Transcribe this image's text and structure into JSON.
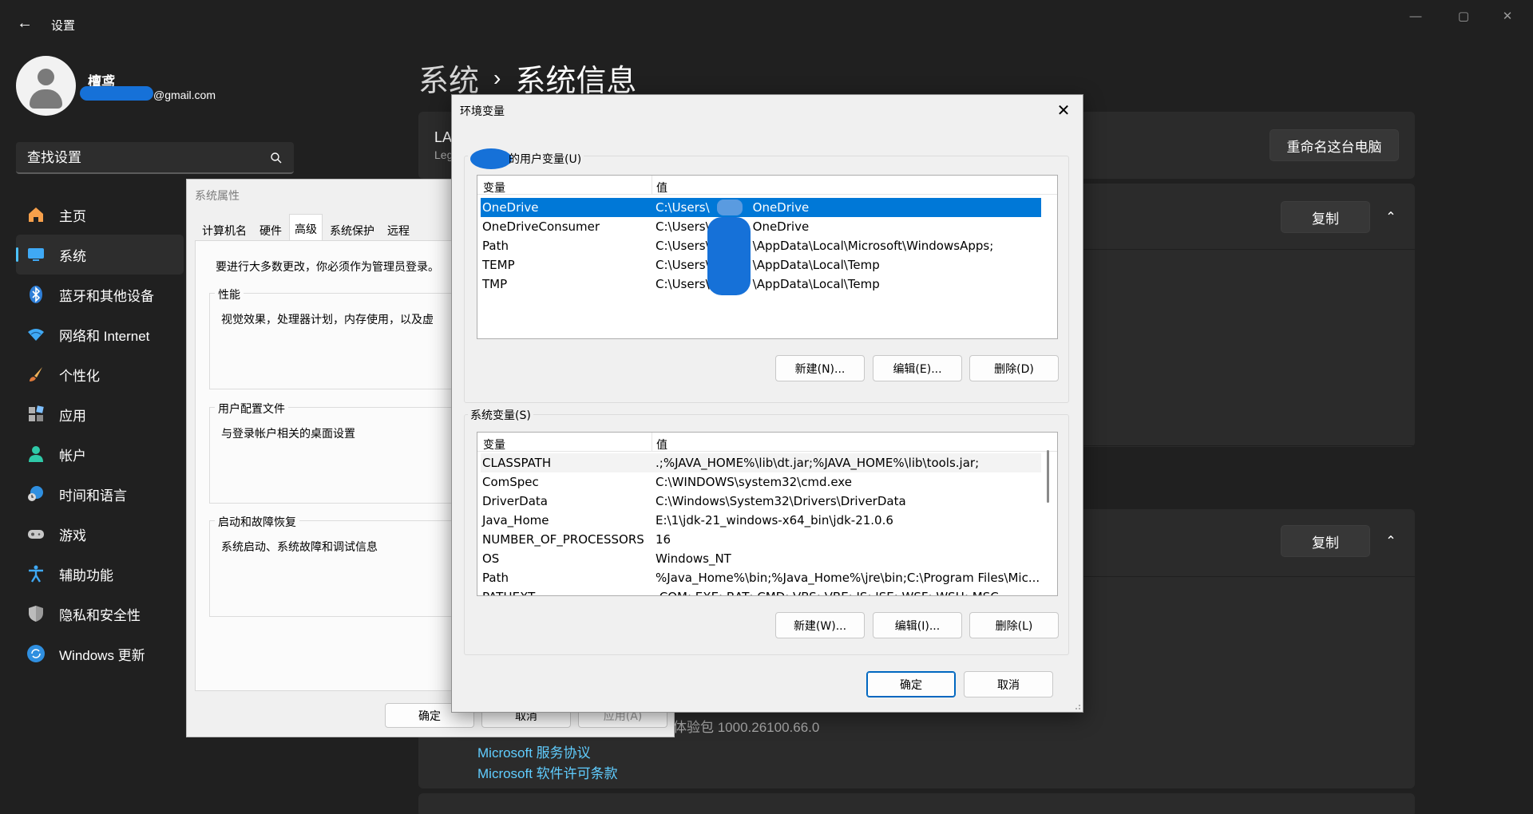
{
  "window": {
    "title": "设置",
    "controls": {
      "minimize": "—",
      "maximize": "▢",
      "close": "✕"
    }
  },
  "profile": {
    "name": "檀鸢",
    "email_suffix": "@gmail.com"
  },
  "search": {
    "placeholder": "查找设置"
  },
  "nav": {
    "items": [
      {
        "label": "主页",
        "icon": "home-icon"
      },
      {
        "label": "系统",
        "icon": "monitor-icon",
        "active": true
      },
      {
        "label": "蓝牙和其他设备",
        "icon": "bluetooth-icon"
      },
      {
        "label": "网络和 Internet",
        "icon": "wifi-icon"
      },
      {
        "label": "个性化",
        "icon": "brush-icon"
      },
      {
        "label": "应用",
        "icon": "apps-icon"
      },
      {
        "label": "帐户",
        "icon": "account-icon"
      },
      {
        "label": "时间和语言",
        "icon": "globe-clock-icon"
      },
      {
        "label": "游戏",
        "icon": "gamepad-icon"
      },
      {
        "label": "辅助功能",
        "icon": "accessibility-icon"
      },
      {
        "label": "隐私和安全性",
        "icon": "shield-icon"
      },
      {
        "label": "Windows 更新",
        "icon": "update-icon"
      }
    ]
  },
  "breadcrumb": {
    "parent": "系统",
    "separator": "›",
    "current": "系统信息"
  },
  "main": {
    "device_name_partial": "LA",
    "device_model_partial": "Leg",
    "rename_button": "重命名这台电脑",
    "copy_button_1": "复制",
    "copy_button_2": "复制",
    "experience_text": "体验包 1000.26100.66.0",
    "link_service": "Microsoft 服务协议",
    "link_license": "Microsoft 软件许可条款"
  },
  "system_properties": {
    "title": "系统属性",
    "tabs": [
      "计算机名",
      "硬件",
      "高级",
      "系统保护",
      "远程"
    ],
    "active_tab": "高级",
    "admin_note": "要进行大多数更改，你必须作为管理员登录。",
    "groups": [
      {
        "title": "性能",
        "text": "视觉效果，处理器计划，内存使用，以及虚"
      },
      {
        "title": "用户配置文件",
        "text": "与登录帐户相关的桌面设置"
      },
      {
        "title": "启动和故障恢复",
        "text": "系统启动、系统故障和调试信息"
      }
    ],
    "buttons": {
      "ok": "确定",
      "cancel": "取消",
      "apply": "应用(A)"
    }
  },
  "env_dialog": {
    "title": "环境变量",
    "user_group_title": "的用户变量(U)",
    "system_group_title": "系统变量(S)",
    "col_variable": "变量",
    "col_value": "值",
    "user_vars": [
      {
        "name": "OneDrive",
        "value_prefix": "C:\\Users\\",
        "value_suffix": "OneDrive",
        "selected": true
      },
      {
        "name": "OneDriveConsumer",
        "value_prefix": "C:\\Users\\",
        "value_suffix": "OneDrive"
      },
      {
        "name": "Path",
        "value_prefix": "C:\\Users\\",
        "value_suffix": "\\AppData\\Local\\Microsoft\\WindowsApps;"
      },
      {
        "name": "TEMP",
        "value_prefix": "C:\\Users\\",
        "value_suffix": "\\AppData\\Local\\Temp"
      },
      {
        "name": "TMP",
        "value_prefix": "C:\\Users\\",
        "value_suffix": "\\AppData\\Local\\Temp"
      }
    ],
    "system_vars": [
      {
        "name": "CLASSPATH",
        "value": ".;%JAVA_HOME%\\lib\\dt.jar;%JAVA_HOME%\\lib\\tools.jar;"
      },
      {
        "name": "ComSpec",
        "value": "C:\\WINDOWS\\system32\\cmd.exe"
      },
      {
        "name": "DriverData",
        "value": "C:\\Windows\\System32\\Drivers\\DriverData"
      },
      {
        "name": "Java_Home",
        "value": "E:\\1\\jdk-21_windows-x64_bin\\jdk-21.0.6"
      },
      {
        "name": "NUMBER_OF_PROCESSORS",
        "value": "16"
      },
      {
        "name": "OS",
        "value": "Windows_NT"
      },
      {
        "name": "Path",
        "value": "%Java_Home%\\bin;%Java_Home%\\jre\\bin;C:\\Program Files\\Mic..."
      },
      {
        "name": "PATHEXT",
        "value": ".COM;.EXE;.BAT;.CMD;.VBS;.VBE;.JS;.JSE;.WSF;.WSH;.MSC"
      }
    ],
    "user_buttons": {
      "new": "新建(N)...",
      "edit": "编辑(E)...",
      "delete": "删除(D)"
    },
    "system_buttons": {
      "new": "新建(W)...",
      "edit": "编辑(I)...",
      "delete": "删除(L)"
    },
    "ok": "确定",
    "cancel": "取消"
  },
  "colors": {
    "background": "#202020",
    "card": "#2b2b2b",
    "accent": "#4cc2ff",
    "selection": "#0078d7",
    "link": "#60cdff",
    "redaction": "#1671d8"
  }
}
